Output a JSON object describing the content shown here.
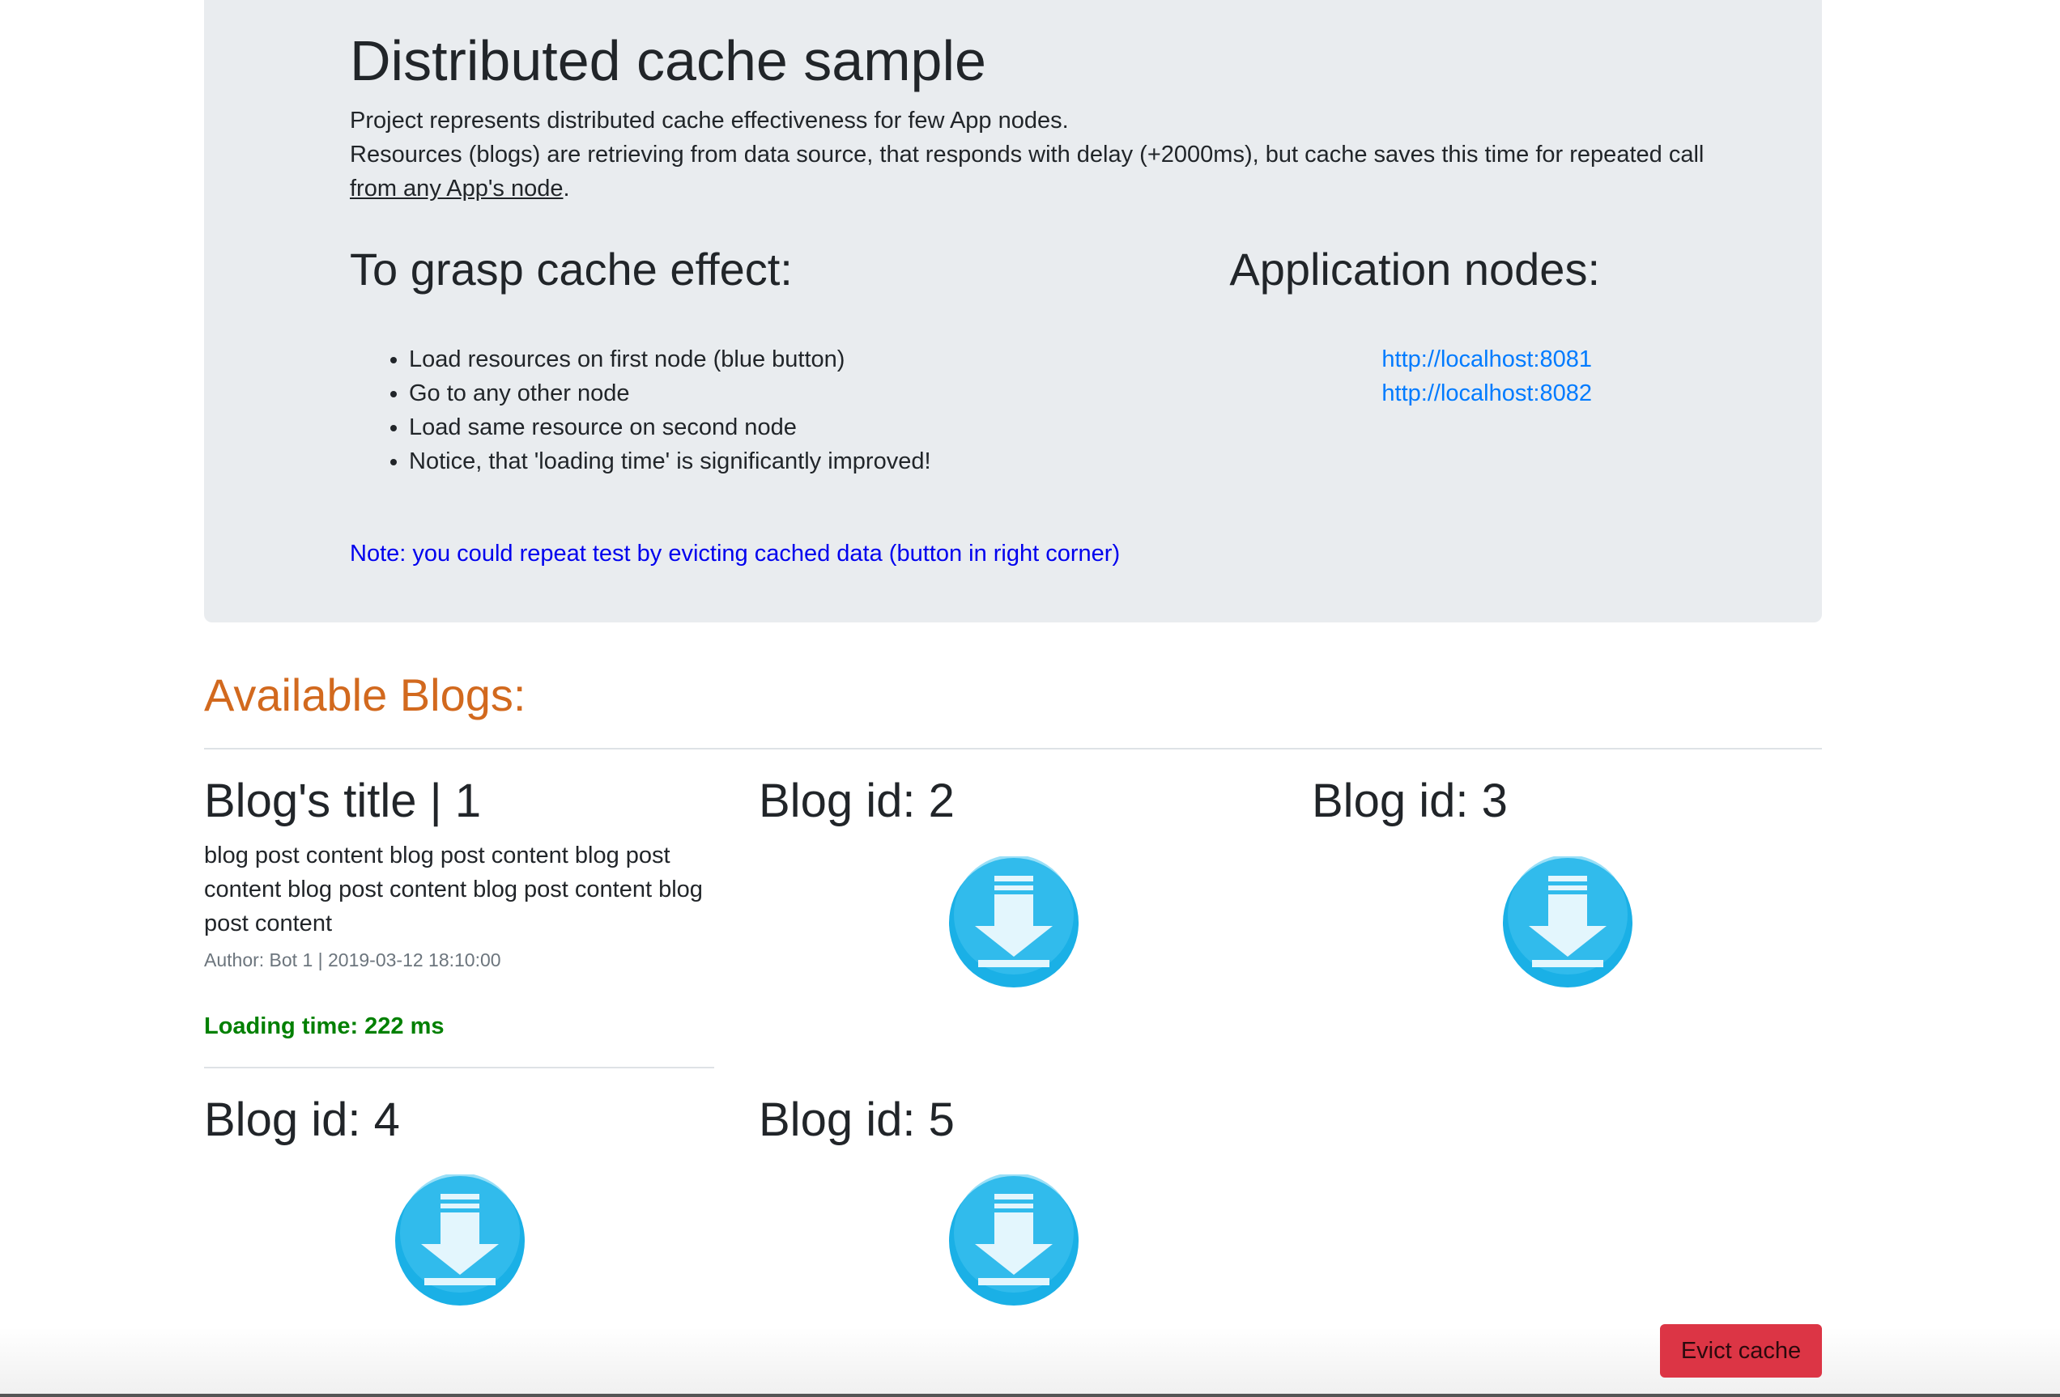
{
  "jumbotron": {
    "title": "Distributed cache sample",
    "desc_line1": "Project represents distributed cache effectiveness for few App nodes.",
    "desc_line2_before": "Resources (blogs) are retrieving from data source, that responds with delay (+2000ms), but cache saves this time for repeated call ",
    "desc_link": "from any App's node",
    "desc_line2_after": ".",
    "steps_heading": "To grasp cache effect:",
    "steps": [
      "Load resources on first node (blue button)",
      "Go to any other node",
      "Load same resource on second node",
      "Notice, that 'loading time' is significantly improved!"
    ],
    "nodes_heading": "Application nodes:",
    "nodes": [
      "http://localhost:8081",
      "http://localhost:8082"
    ],
    "note": "Note: you could repeat test by evicting cached data (button in right corner)"
  },
  "blogs": {
    "heading": "Available Blogs:",
    "loaded": {
      "title": "Blog's title | 1",
      "content": "blog post content blog post content blog post content blog post content blog post content blog post content",
      "meta": "Author: Bot 1 | 2019-03-12 18:10:00",
      "loading_time": "Loading time: 222 ms"
    },
    "pending": [
      {
        "title": "Blog id: 2",
        "icon": "download-icon"
      },
      {
        "title": "Blog id: 3",
        "icon": "download-icon"
      },
      {
        "title": "Blog id: 4",
        "icon": "download-icon"
      },
      {
        "title": "Blog id: 5",
        "icon": "download-icon"
      }
    ]
  },
  "actions": {
    "evict_label": "Evict cache"
  },
  "colors": {
    "jumbotron_bg": "#e9ecef",
    "link": "#007bff",
    "note": "#0000ee",
    "blogs_heading": "#d2691e",
    "loading_time": "#008000",
    "evict_button": "#dc3545",
    "download_icon": "#29b6e8"
  }
}
